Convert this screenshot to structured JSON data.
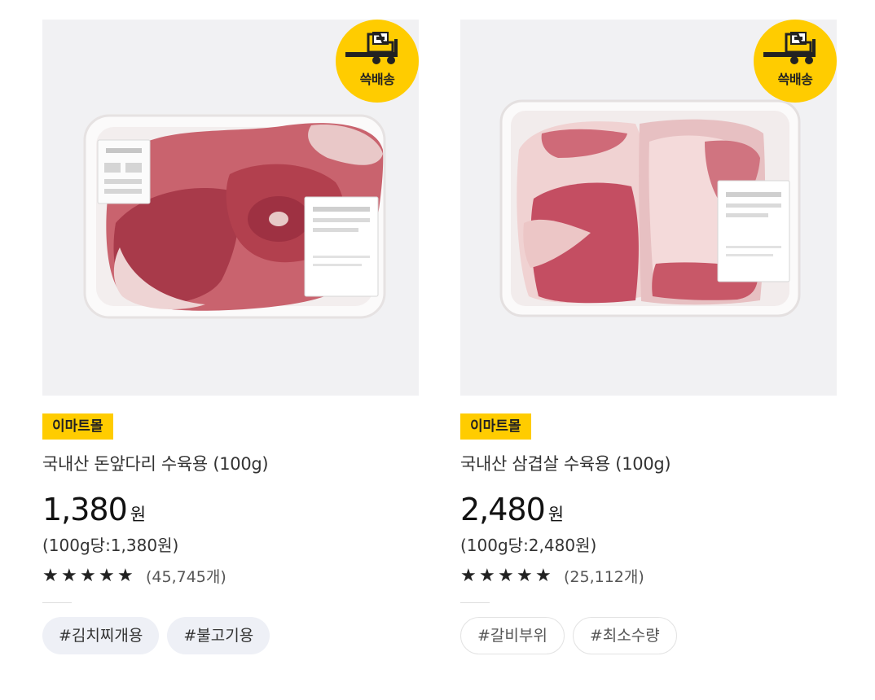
{
  "products": [
    {
      "badge": "쓱배송",
      "mall": "이마트몰",
      "title": "국내산 돈앞다리 수육용 (100g)",
      "price": "1,380",
      "currency": "원",
      "unit_price": "(100g당:1,380원)",
      "rating": 5,
      "review_count": "(45,745개)",
      "tags": [
        "#김치찌개용",
        "#불고기용"
      ],
      "colors": {
        "badge": "#ffcc00",
        "mall_tag": "#ffcc00",
        "tag_bg": "#eef0f6"
      }
    },
    {
      "badge": "쓱배송",
      "mall": "이마트몰",
      "title": "국내산 삼겹살 수육용 (100g)",
      "price": "2,480",
      "currency": "원",
      "unit_price": "(100g당:2,480원)",
      "rating": 5,
      "review_count": "(25,112개)",
      "tags": [
        "#갈비부위",
        "#최소수량"
      ],
      "colors": {
        "badge": "#ffcc00",
        "mall_tag": "#ffcc00",
        "tag_border": "#e3e3e3"
      }
    }
  ]
}
